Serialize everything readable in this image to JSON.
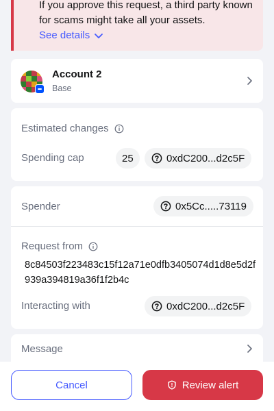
{
  "alert": {
    "text": "If you approve this request, a third party known for scams might take all your assets.",
    "link_label": "See details"
  },
  "account": {
    "name": "Account 2",
    "network": "Base"
  },
  "estimated_changes": {
    "title": "Estimated changes",
    "spending_cap_label": "Spending cap",
    "amount": "25",
    "token_address": "0xdC200...d2c5F"
  },
  "details": {
    "spender_label": "Spender",
    "spender_address": "0x5Cc.....73119",
    "request_from_label": "Request from",
    "request_from_value": "8c84503f223483c15f12a71e0dfb3405074d1d8e5d2f939a394819a36f1f2b4c",
    "interacting_with_label": "Interacting with",
    "interacting_with_address": "0xdC200...d2c5F"
  },
  "message": {
    "label": "Message"
  },
  "footer": {
    "cancel_label": "Cancel",
    "review_label": "Review alert"
  },
  "colors": {
    "accent": "#4459ff",
    "danger": "#d73847",
    "alert_bg": "#f8e6e8"
  }
}
